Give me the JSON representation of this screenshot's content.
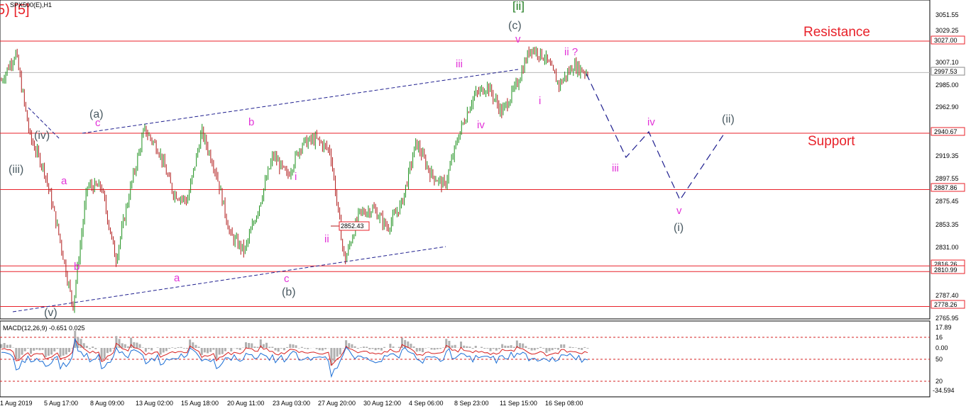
{
  "symbol_title": "SPX500(E),H1",
  "header_degree": "5) [5]",
  "colors": {
    "grid_bg": "#ffffff",
    "level_line": "#e8222a",
    "trend_line": "#1f1f8f",
    "bull_candle": "#1a8f1a",
    "bear_candle": "#b01a1a",
    "magenta": "#e233d8",
    "gray_label": "#4a5a62",
    "green_label": "#1e7a1e",
    "red_text": "#e8222a",
    "macd_hist": "#b0b0b0",
    "macd_signal": "#d62020",
    "macd_line": "#1c6fd6"
  },
  "price_axis": {
    "ticks": [
      "3051.55",
      "3029.25",
      "3007.10",
      "2985.00",
      "2962.90",
      "2940.67",
      "2919.35",
      "2897.55",
      "2875.45",
      "2853.35",
      "2831.00",
      "2809.15",
      "2787.40",
      "2765.95"
    ]
  },
  "level_labels": {
    "resistance": "Resistance",
    "support": "Support"
  },
  "price_tags": {
    "r1": "3027.00",
    "current": "2997.53",
    "s1": "2940.67",
    "s2": "2887.86",
    "s3": "2816.26",
    "s4": "2810.99",
    "s5": "2778.26",
    "low_marker": "2852.43"
  },
  "wave_labels": {
    "deg_ii_green": "[ii]",
    "c_paren": "(c)",
    "v_top": "v",
    "ii_q": "ii ?",
    "i_small": "i",
    "iii_top": "iii",
    "iv_mid": "iv",
    "a_paren": "(a)",
    "c_small": "c",
    "b_top": "b",
    "iv_paren": "(iv)",
    "iii_paren": "(iii)",
    "a_small": "a",
    "b_small": "b",
    "v_paren": "(v)",
    "a_low": "a",
    "i_mid": "i",
    "ii_mid": "ii",
    "c_low": "c",
    "b_paren": "(b)",
    "proj_iii": "iii",
    "proj_iv": "iv",
    "proj_v": "v",
    "proj_i_paren": "(i)",
    "proj_ii_paren": "(ii)"
  },
  "time_axis": [
    "1 Aug 2019",
    "5 Aug 17:00",
    "8 Aug 09:00",
    "13 Aug 02:00",
    "15 Aug 18:00",
    "20 Aug 11:00",
    "23 Aug 03:00",
    "27 Aug 20:00",
    "30 Aug 12:00",
    "4 Sep 06:00",
    "8 Sep 23:00",
    "11 Sep 15:00",
    "16 Sep 08:00"
  ],
  "macd_panel": {
    "title": "MACD(12,26,9) -0.651 0.025",
    "ticks": [
      "17.89",
      "16",
      "0.00",
      "50",
      "20",
      "-34.594"
    ]
  },
  "chart_data": {
    "type": "candlestick",
    "symbol": "SPX500(E)",
    "timeframe": "H1",
    "ylim": [
      2765.95,
      3051.55
    ],
    "horizontal_levels": [
      3027.0,
      2997.53,
      2940.67,
      2887.86,
      2816.26,
      2810.99,
      2778.26
    ],
    "close_path": [
      {
        "x": "1 Aug 2019",
        "y": 2990
      },
      {
        "x": "1 Aug 2019",
        "y": 3016
      },
      {
        "x": "2 Aug 2019",
        "y": 2937
      },
      {
        "x": "2 Aug 2019",
        "y": 2906
      },
      {
        "x": "5 Aug 2019",
        "y": 2847
      },
      {
        "x": "5 Aug 17:00",
        "y": 2778
      },
      {
        "x": "6 Aug 2019",
        "y": 2891
      },
      {
        "x": "7 Aug 2019",
        "y": 2890
      },
      {
        "x": "7 Aug 2019",
        "y": 2822
      },
      {
        "x": "8 Aug 09:00",
        "y": 2888
      },
      {
        "x": "8 Aug 09:00",
        "y": 2944
      },
      {
        "x": "9 Aug 2019",
        "y": 2925
      },
      {
        "x": "12 Aug 2019",
        "y": 2885
      },
      {
        "x": "12 Aug 2019",
        "y": 2877
      },
      {
        "x": "13 Aug 02:00",
        "y": 2942
      },
      {
        "x": "14 Aug 2019",
        "y": 2905
      },
      {
        "x": "14 Aug 2019",
        "y": 2845
      },
      {
        "x": "15 Aug 18:00",
        "y": 2830
      },
      {
        "x": "16 Aug 2019",
        "y": 2872
      },
      {
        "x": "19 Aug 2019",
        "y": 2920
      },
      {
        "x": "20 Aug 11:00",
        "y": 2900
      },
      {
        "x": "21 Aug 2019",
        "y": 2931
      },
      {
        "x": "22 Aug 2019",
        "y": 2935
      },
      {
        "x": "23 Aug 03:00",
        "y": 2924
      },
      {
        "x": "23 Aug 03:00",
        "y": 2820
      },
      {
        "x": "26 Aug 2019",
        "y": 2865
      },
      {
        "x": "26 Aug 2019",
        "y": 2870
      },
      {
        "x": "27 Aug 20:00",
        "y": 2852
      },
      {
        "x": "28 Aug 2019",
        "y": 2875
      },
      {
        "x": "29 Aug 2019",
        "y": 2932
      },
      {
        "x": "30 Aug 12:00",
        "y": 2903
      },
      {
        "x": "3 Sep 2019",
        "y": 2891
      },
      {
        "x": "4 Sep 06:00",
        "y": 2940
      },
      {
        "x": "5 Sep 2019",
        "y": 2975
      },
      {
        "x": "6 Sep 2019",
        "y": 2985
      },
      {
        "x": "8 Sep 23:00",
        "y": 2960
      },
      {
        "x": "10 Sep 2019",
        "y": 2985
      },
      {
        "x": "11 Sep 15:00",
        "y": 3021
      },
      {
        "x": "12 Sep 2019",
        "y": 3012
      },
      {
        "x": "13 Sep 2019",
        "y": 2986
      },
      {
        "x": "16 Sep 08:00",
        "y": 3004
      },
      {
        "x": "17 Sep 2019",
        "y": 2997
      }
    ]
  }
}
